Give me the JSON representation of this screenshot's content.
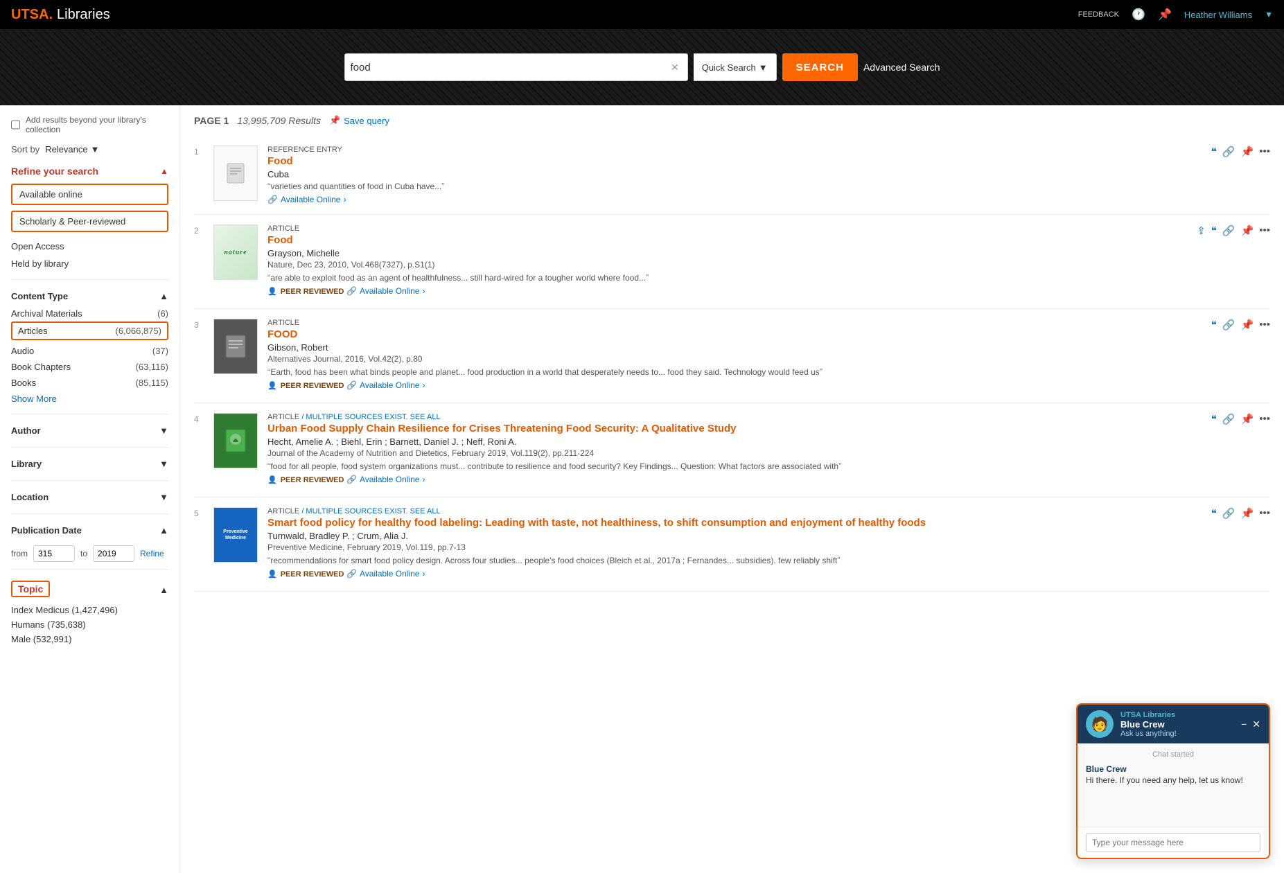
{
  "topnav": {
    "logo_utsa": "UTSA.",
    "logo_libraries": "Libraries",
    "feedback": "FEEDBACK",
    "user_name": "Heather Williams"
  },
  "search": {
    "query": "food",
    "clear_label": "✕",
    "quick_search_label": "Quick Search",
    "quick_search_arrow": "▼",
    "submit_label": "SEARCH",
    "advanced_search_label": "Advanced Search"
  },
  "results_header": {
    "page_label": "PAGE 1",
    "results_count": "13,995,709 Results",
    "save_query_label": "Save query",
    "save_query_icon": "📌"
  },
  "sidebar": {
    "add_results_label": "Add results beyond your library's collection",
    "sort_label": "Sort by",
    "sort_value": "Relevance",
    "sort_arrow": "▼",
    "refine_label": "Refine your search",
    "filter_available_online": "Available online",
    "filter_scholarly": "Scholarly & Peer-reviewed",
    "filter_open_access": "Open Access",
    "filter_held_by_library": "Held by library",
    "content_type_label": "Content Type",
    "content_types": [
      {
        "label": "Archival Materials",
        "count": "(6)",
        "highlighted": false
      },
      {
        "label": "Articles",
        "count": "(6,066,875)",
        "highlighted": true
      },
      {
        "label": "Audio",
        "count": "(37)",
        "highlighted": false
      },
      {
        "label": "Book Chapters",
        "count": "(63,116)",
        "highlighted": false
      },
      {
        "label": "Books",
        "count": "(85,115)",
        "highlighted": false
      }
    ],
    "show_more_label": "Show More",
    "author_label": "Author",
    "library_label": "Library",
    "location_label": "Location",
    "pub_date_label": "Publication Date",
    "pub_date_from_label": "from",
    "pub_date_to_label": "to",
    "pub_date_from": "315",
    "pub_date_to": "2019",
    "pub_date_refine": "Refine",
    "topic_label": "Topic",
    "topics": [
      {
        "label": "Index Medicus",
        "count": "(1,427,496)"
      },
      {
        "label": "Humans",
        "count": "(735,638)"
      },
      {
        "label": "Male",
        "count": "(532,991)"
      }
    ]
  },
  "results": [
    {
      "number": "1",
      "type": "REFERENCE ENTRY",
      "title": "Food",
      "author": "Cuba",
      "source": "",
      "snippet": "varieties and quantities of food in Cuba have...",
      "snippet_highlight": "food",
      "peer_reviewed": false,
      "available_online": true,
      "available_online_label": "Available Online",
      "thumb_type": "placeholder"
    },
    {
      "number": "2",
      "type": "ARTICLE",
      "title": "Food",
      "author": "Grayson, Michelle",
      "source": "Nature, Dec 23, 2010, Vol.468(7327), p.S1(1)",
      "snippet": "are able to exploit food as an agent of healthfulness... still hard-wired for a tougher world where food...",
      "peer_reviewed": true,
      "peer_reviewed_label": "PEER REVIEWED",
      "available_online": true,
      "available_online_label": "Available Online",
      "thumb_type": "nature"
    },
    {
      "number": "3",
      "type": "ARTICLE",
      "title": "FOOD",
      "author": "Gibson, Robert",
      "source": "Alternatives Journal, 2016, Vol.42(2), p.80",
      "snippet": "Earth, food has been what binds people and planet... food production in a world that desperately needs to... food they said. Technology would feed us",
      "peer_reviewed": true,
      "peer_reviewed_label": "PEER REVIEWED",
      "available_online": true,
      "available_online_label": "Available Online",
      "thumb_type": "dark"
    },
    {
      "number": "4",
      "type": "ARTICLE",
      "type_suffix": "/ multiple sources exist. see all",
      "title": "Urban Food Supply Chain Resilience for Crises Threatening Food Security: A Qualitative Study",
      "author": "Hecht, Amelie A. ; Biehl, Erin ; Barnett, Daniel J. ; Neff, Roni A.",
      "source": "Journal of the Academy of Nutrition and Dietetics, February 2019, Vol.119(2), pp.211-224",
      "snippet": "food for all people, food system organizations must... contribute to resilience and food security? Key Findings... Question: What factors are associated with",
      "peer_reviewed": true,
      "peer_reviewed_label": "PEER REVIEWED",
      "available_online": true,
      "available_online_label": "Available Online",
      "thumb_type": "green"
    },
    {
      "number": "5",
      "type": "ARTICLE",
      "type_suffix": "/ multiple sources exist. see all",
      "title": "Smart food policy for healthy food labeling: Leading with taste, not healthiness, to shift consumption and enjoyment of healthy foods",
      "author": "Turnwald, Bradley P. ; Crum, Alia J.",
      "source": "Preventive Medicine, February 2019, Vol.119, pp.7-13",
      "snippet": "recommendations for smart food policy design. Across four studies... people's food choices (Bleich et al., 2017a ; Fernandes... subsidies). few reliably shift",
      "peer_reviewed": true,
      "peer_reviewed_label": "PEER REVIEWED",
      "available_online": true,
      "available_online_label": "Available Online",
      "thumb_type": "policy"
    }
  ],
  "chat": {
    "brand": "UTSA Libraries",
    "agent_name": "Blue Crew",
    "agent_subtitle": "Ask us anything!",
    "chat_started_label": "Chat started",
    "message_sender": "Blue Crew",
    "message_text": "Hi there. If you need any help, let us know!",
    "input_placeholder": "Type your message here",
    "close_icon": "✕",
    "minimize_icon": "−"
  }
}
